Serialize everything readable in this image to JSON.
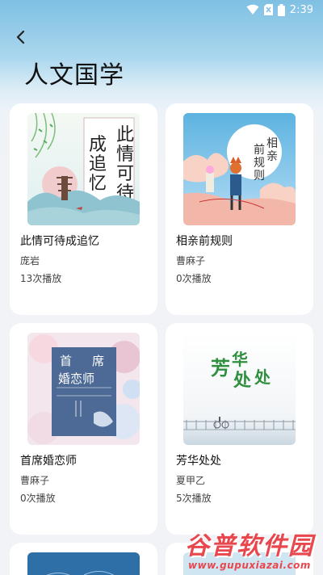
{
  "status_bar": {
    "time": "2:39",
    "icons": [
      "wifi-icon",
      "sim-blocked-icon",
      "battery-icon"
    ]
  },
  "header": {
    "back_icon": "back-arrow-icon",
    "title": "人文国学"
  },
  "cards": [
    {
      "title": "此情可待成追忆",
      "author": "庞岩",
      "plays": "13次播放",
      "cover_text": "此情可待成追忆"
    },
    {
      "title": "相亲前规则",
      "author": "曹麻子",
      "plays": "0次播放",
      "cover_text": "相亲前规则"
    },
    {
      "title": "首席婚恋师",
      "author": "曹麻子",
      "plays": "0次播放",
      "cover_text": "首席婚恋师"
    },
    {
      "title": "芳华处处",
      "author": "夏甲乙",
      "plays": "5次播放",
      "cover_text": "芳华处处"
    }
  ],
  "watermark": {
    "main": "谷普软件园",
    "url": "www.gupuxiazai.com"
  },
  "colors": {
    "header_gradient_top": "#7fc0e3",
    "background": "#f1f3f6",
    "card": "#ffffff",
    "watermark": "#e8474d"
  }
}
